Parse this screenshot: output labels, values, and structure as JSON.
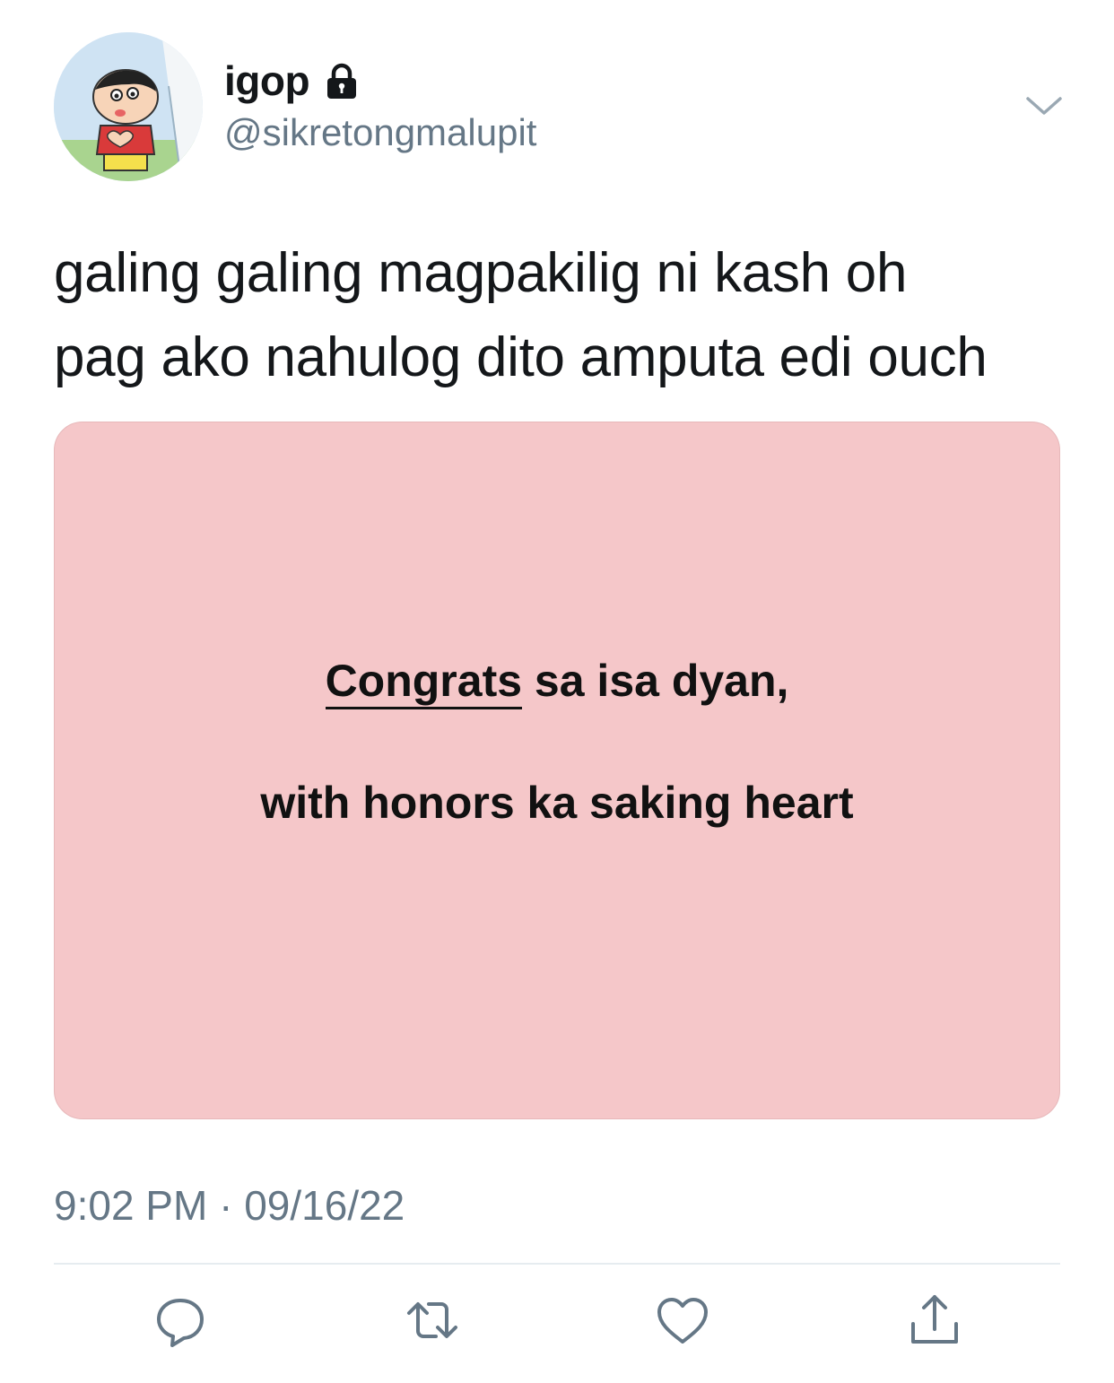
{
  "user": {
    "display_name": "igop",
    "handle": "@sikretongmalupit",
    "protected_icon": "lock-icon"
  },
  "tweet": {
    "text_lines": [
      "galing galing magpakilig ni kash oh",
      "pag ako nahulog dito amputa edi ouch"
    ],
    "time": "9:02 PM",
    "separator": "·",
    "date": "09/16/22"
  },
  "media": {
    "background": "#f5c7c9",
    "line1_underlined": "Congrats",
    "line1_rest": " sa isa dyan,",
    "line2": "with honors ka saking heart"
  },
  "actions": {
    "reply_icon": "reply-icon",
    "retweet_icon": "retweet-icon",
    "like_icon": "heart-icon",
    "share_icon": "share-icon"
  },
  "colors": {
    "text": "#14171a",
    "secondary": "#657786",
    "divider": "#e6ecf0"
  }
}
